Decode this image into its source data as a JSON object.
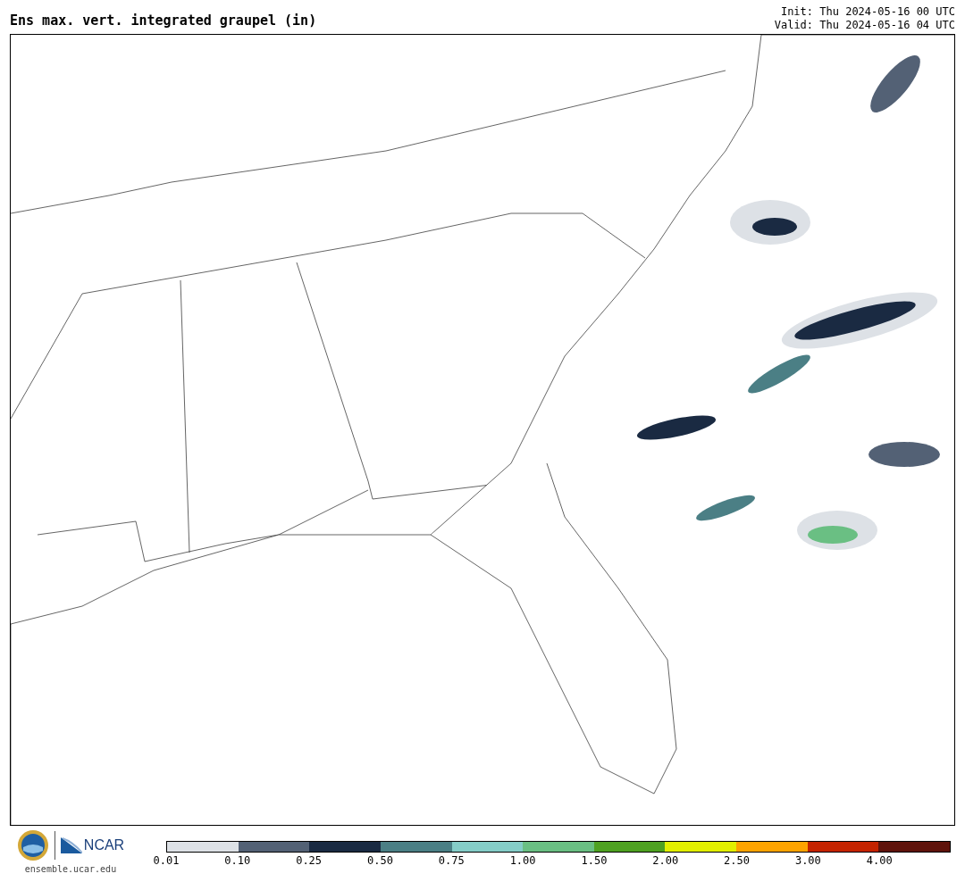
{
  "title": "Ens max. vert. integrated graupel (in)",
  "init": "Init: Thu 2024-05-16 00 UTC",
  "valid": "Valid: Thu 2024-05-16 04 UTC",
  "logos": {
    "ncar": "NCAR",
    "site": "ensemble.ucar.edu"
  },
  "colorbar": {
    "bins": [
      {
        "color": "#dde1e6"
      },
      {
        "color": "#536175"
      },
      {
        "color": "#1a2a42"
      },
      {
        "color": "#4b7f85"
      },
      {
        "color": "#85cdc8"
      },
      {
        "color": "#6abf83"
      },
      {
        "color": "#4fa122"
      },
      {
        "color": "#e2ef00"
      },
      {
        "color": "#fda300"
      },
      {
        "color": "#c42300"
      },
      {
        "color": "#5f130b"
      }
    ],
    "ticks": [
      "0.01",
      "0.10",
      "0.25",
      "0.50",
      "0.75",
      "1.00",
      "1.50",
      "2.00",
      "2.50",
      "3.00",
      "4.00"
    ]
  }
}
